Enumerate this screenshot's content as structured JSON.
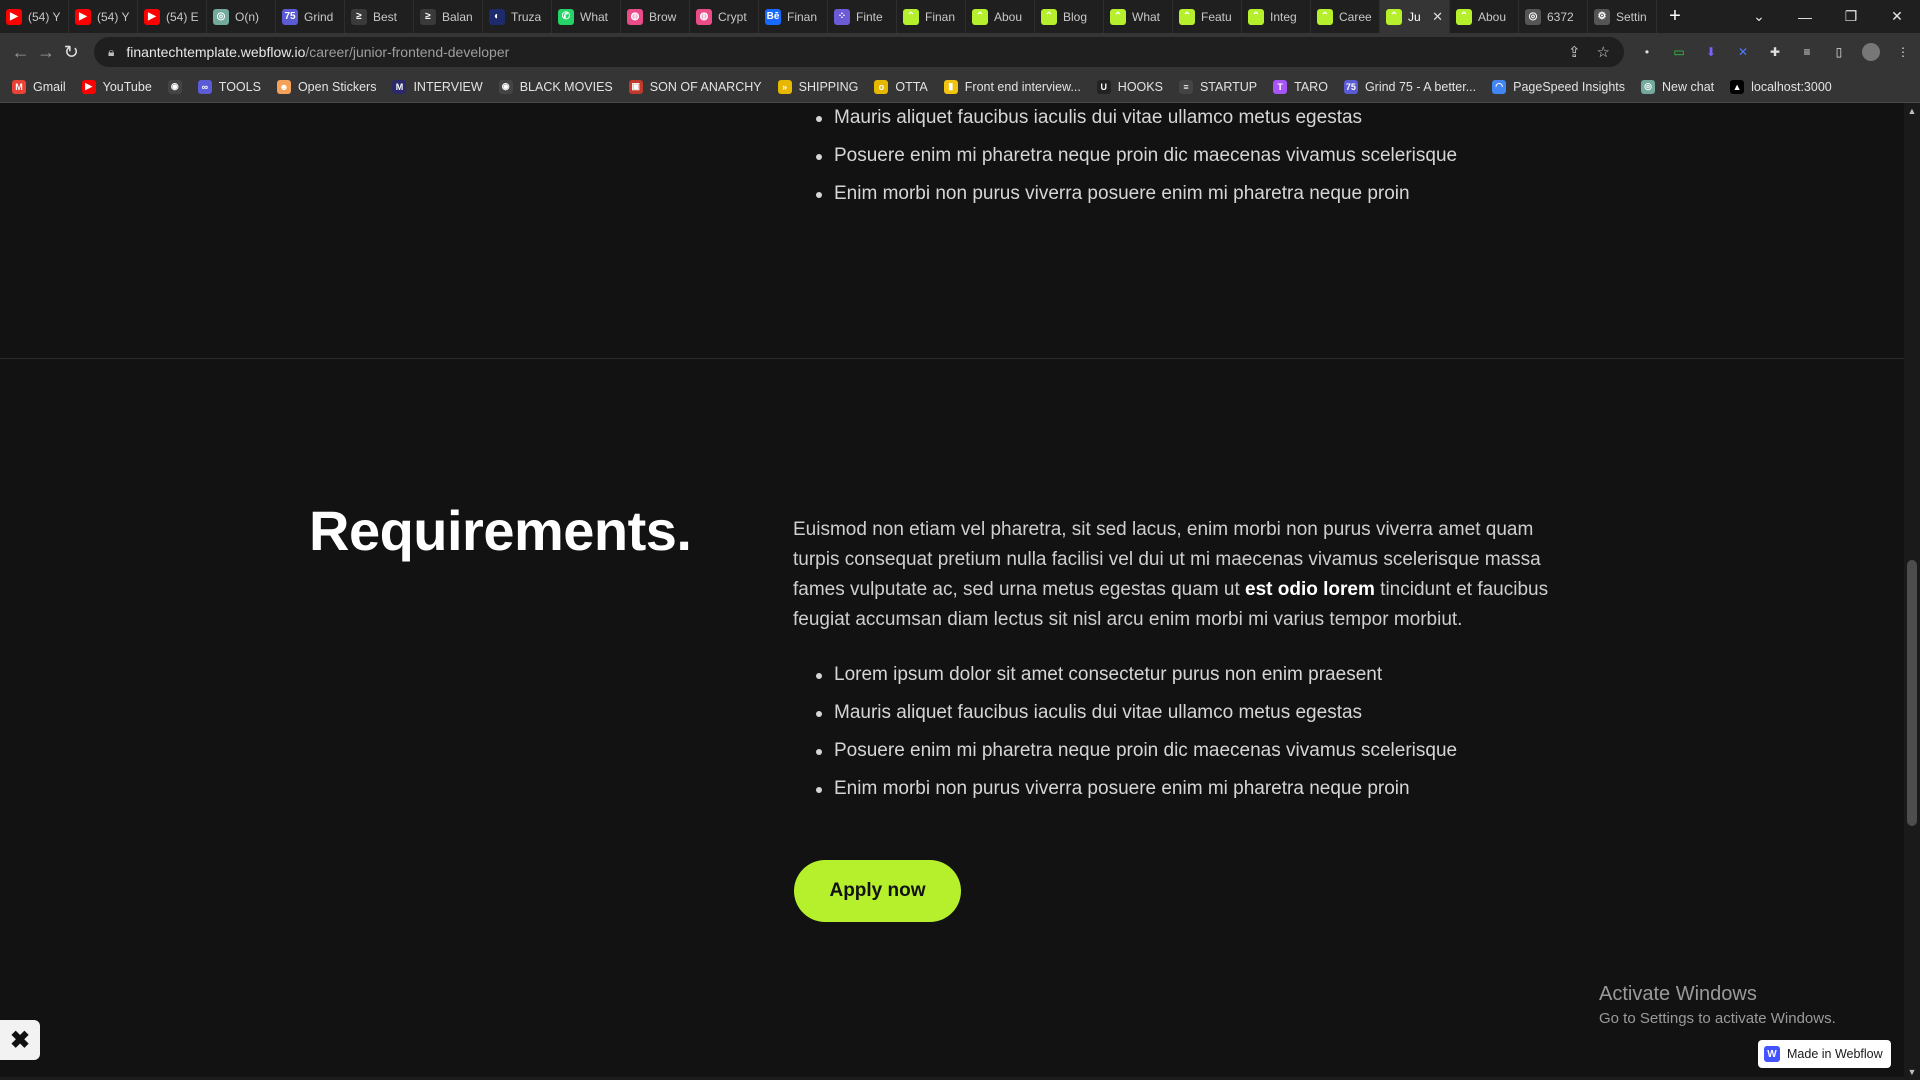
{
  "browser": {
    "tabs": [
      {
        "title": "(54) Y",
        "icon": "youtube-icon",
        "color": "#ff0000",
        "glyph": "▶"
      },
      {
        "title": "(54) Y",
        "icon": "youtube-icon",
        "color": "#ff0000",
        "glyph": "▶"
      },
      {
        "title": "(54) E",
        "icon": "youtube-icon",
        "color": "#ff0000",
        "glyph": "▶"
      },
      {
        "title": "O(n)",
        "icon": "chatgpt-icon",
        "color": "#74aa9c",
        "glyph": "◎"
      },
      {
        "title": "Grind",
        "icon": "grind75-icon",
        "color": "#5b5bd6",
        "glyph": "75"
      },
      {
        "title": "Best",
        "icon": "site-icon",
        "color": "#3a3a3a",
        "glyph": "≥"
      },
      {
        "title": "Balan",
        "icon": "site-icon",
        "color": "#3a3a3a",
        "glyph": "≥"
      },
      {
        "title": "Truza",
        "icon": "site-icon",
        "color": "#1d2a6b",
        "glyph": "◐"
      },
      {
        "title": "What",
        "icon": "whatsapp-icon",
        "color": "#25d366",
        "glyph": "✆"
      },
      {
        "title": "Brow",
        "icon": "dribbble-icon",
        "color": "#ea4c89",
        "glyph": "◍"
      },
      {
        "title": "Crypt",
        "icon": "dribbble-icon",
        "color": "#ea4c89",
        "glyph": "◍"
      },
      {
        "title": "Finan",
        "icon": "behance-icon",
        "color": "#1769ff",
        "glyph": "Bē"
      },
      {
        "title": "Finte",
        "icon": "grid-icon",
        "color": "#6b5bd6",
        "glyph": "⁘"
      },
      {
        "title": "Finan",
        "icon": "webflow-template-icon",
        "color": "#b6ef2b",
        "glyph": "⌃"
      },
      {
        "title": "Abou",
        "icon": "webflow-template-icon",
        "color": "#b6ef2b",
        "glyph": "⌃"
      },
      {
        "title": "Blog",
        "icon": "webflow-template-icon",
        "color": "#b6ef2b",
        "glyph": "⌃"
      },
      {
        "title": "What",
        "icon": "webflow-template-icon",
        "color": "#b6ef2b",
        "glyph": "⌃"
      },
      {
        "title": "Featu",
        "icon": "webflow-template-icon",
        "color": "#b6ef2b",
        "glyph": "⌃"
      },
      {
        "title": "Integ",
        "icon": "webflow-template-icon",
        "color": "#b6ef2b",
        "glyph": "⌃"
      },
      {
        "title": "Caree",
        "icon": "webflow-template-icon",
        "color": "#b6ef2b",
        "glyph": "⌃"
      },
      {
        "title": "Ju",
        "icon": "webflow-template-icon",
        "color": "#b6ef2b",
        "glyph": "⌃",
        "active": true
      },
      {
        "title": "Abou",
        "icon": "webflow-template-icon",
        "color": "#b6ef2b",
        "glyph": "⌃"
      },
      {
        "title": "6372",
        "icon": "globe-icon",
        "color": "#555555",
        "glyph": "◎"
      },
      {
        "title": "Settin",
        "icon": "settings-icon",
        "color": "#555555",
        "glyph": "⚙"
      }
    ],
    "url_host": "finantechtemplate.webflow.io",
    "url_path": "/career/junior-frontend-developer",
    "bookmarks": [
      {
        "label": "Gmail",
        "icon": "gmail-icon",
        "color": "#ea4335",
        "glyph": "M"
      },
      {
        "label": "YouTube",
        "icon": "youtube-icon",
        "color": "#ff0000",
        "glyph": "▶"
      },
      {
        "label": "",
        "icon": "globe-icon",
        "color": "#444444",
        "glyph": "◉"
      },
      {
        "label": "TOOLS",
        "icon": "folder-icon",
        "color": "#5b5bd6",
        "glyph": "∞"
      },
      {
        "label": "Open Stickers",
        "icon": "stickers-icon",
        "color": "#f4a259",
        "glyph": "☻"
      },
      {
        "label": "INTERVIEW",
        "icon": "folder-icon",
        "color": "#2a2a6a",
        "glyph": "M"
      },
      {
        "label": "BLACK MOVIES",
        "icon": "globe-icon",
        "color": "#444444",
        "glyph": "◉"
      },
      {
        "label": "SON OF ANARCHY",
        "icon": "folder-icon",
        "color": "#c0392b",
        "glyph": "▣"
      },
      {
        "label": "SHIPPING",
        "icon": "folder-icon",
        "color": "#e6b800",
        "glyph": "»"
      },
      {
        "label": "OTTA",
        "icon": "otta-icon",
        "color": "#e6b800",
        "glyph": "o"
      },
      {
        "label": "Front end interview...",
        "icon": "bookmark-icon",
        "color": "#f1c40f",
        "glyph": "▮"
      },
      {
        "label": "HOOKS",
        "icon": "folder-icon",
        "color": "#222222",
        "glyph": "U"
      },
      {
        "label": "STARTUP",
        "icon": "folder-icon",
        "color": "#444444",
        "glyph": "≡"
      },
      {
        "label": "TARO",
        "icon": "taro-icon",
        "color": "#a855f7",
        "glyph": "T"
      },
      {
        "label": "Grind 75 - A better...",
        "icon": "grind75-icon",
        "color": "#5b5bd6",
        "glyph": "75"
      },
      {
        "label": "PageSpeed Insights",
        "icon": "pagespeed-icon",
        "color": "#4285f4",
        "glyph": "◠"
      },
      {
        "label": "New chat",
        "icon": "chatgpt-icon",
        "color": "#74aa9c",
        "glyph": "◎"
      },
      {
        "label": "localhost:3000",
        "icon": "triangle-icon",
        "color": "#000000",
        "glyph": "▲"
      }
    ]
  },
  "page": {
    "top_list": [
      "Mauris aliquet faucibus iaculis dui vitae ullamco metus egestas",
      "Posuere enim mi pharetra neque proin dic maecenas vivamus scelerisque",
      "Enim morbi non purus viverra posuere enim mi pharetra neque proin"
    ],
    "requirements": {
      "title": "Requirements.",
      "body_before": "Euismod non etiam vel pharetra, sit sed lacus, enim morbi non purus viverra amet quam turpis consequat pretium nulla facilisi vel dui ut mi maecenas vivamus scelerisque massa fames vulputate ac, sed urna metus egestas quam ut ",
      "body_bold": "est odio lorem",
      "body_after": " tincidunt et faucibus feugiat accumsan diam lectus sit nisl arcu enim morbi mi varius  tempor morbiut.",
      "list": [
        "Lorem ipsum dolor sit amet consectetur purus non enim praesent",
        "Mauris aliquet faucibus iaculis dui vitae ullamco metus egestas",
        "Posuere enim mi pharetra neque proin dic maecenas vivamus scelerisque",
        "Enim morbi non purus viverra posuere enim mi pharetra neque proin"
      ]
    },
    "apply_label": "Apply now",
    "accent_color": "#b6ef2b",
    "activate_title": "Activate Windows",
    "activate_sub": "Go to Settings to activate Windows.",
    "webflow_badge": "Made in Webflow"
  }
}
